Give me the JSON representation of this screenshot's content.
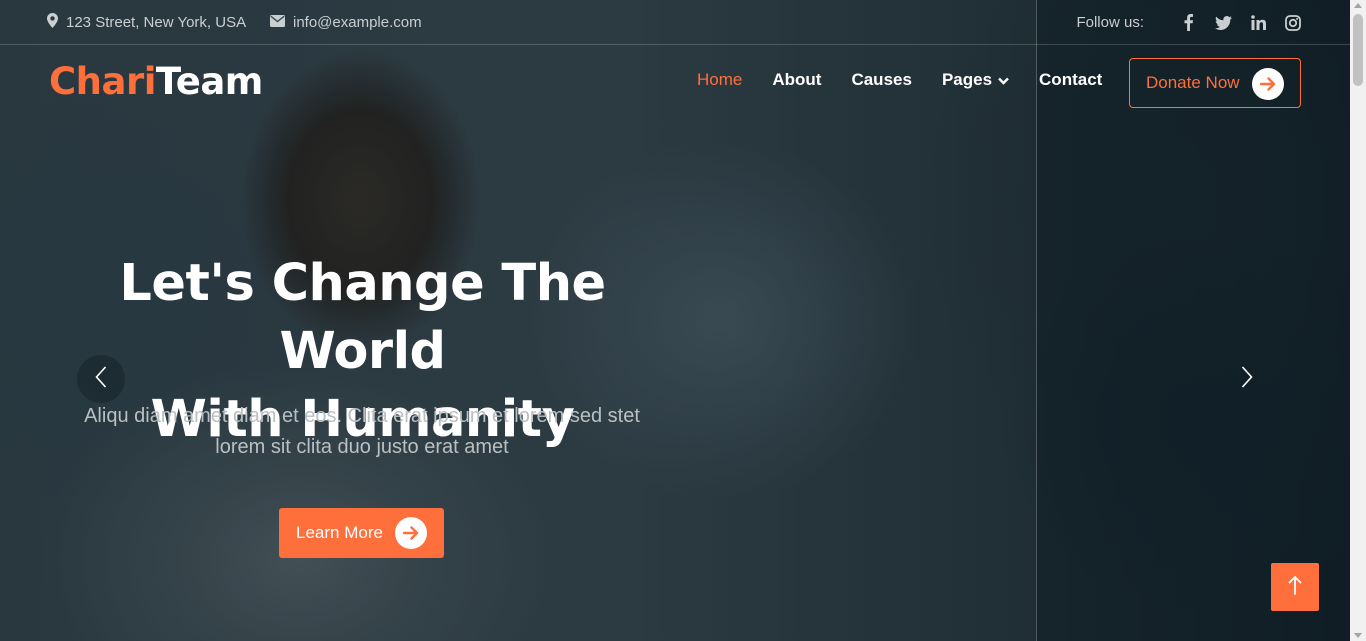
{
  "topbar": {
    "address": "123 Street, New York, USA",
    "address_icon": "map-marker-icon",
    "email": "info@example.com",
    "email_icon": "envelope-icon",
    "follow_label": "Follow us:",
    "socials": [
      "facebook-icon",
      "twitter-icon",
      "linkedin-icon",
      "instagram-icon"
    ]
  },
  "brand": {
    "part1": "Chari",
    "part2": "Team"
  },
  "nav": {
    "items": [
      {
        "label": "Home",
        "active": true
      },
      {
        "label": "About"
      },
      {
        "label": "Causes"
      },
      {
        "label": "Pages",
        "dropdown": true
      },
      {
        "label": "Contact"
      }
    ],
    "donate_label": "Donate Now"
  },
  "hero": {
    "headline_line1": "Let's Change The World",
    "headline_line2": "With Humanity",
    "subtext_line1": "Aliqu diam amet diam et eos. Clita erat ipsum et lorem sed stet",
    "subtext_line2": "lorem sit clita duo justo erat amet",
    "cta_label": "Learn More"
  },
  "colors": {
    "accent": "#ff6f3c",
    "text_light": "#ffffff",
    "muted": "#c9ced1"
  }
}
